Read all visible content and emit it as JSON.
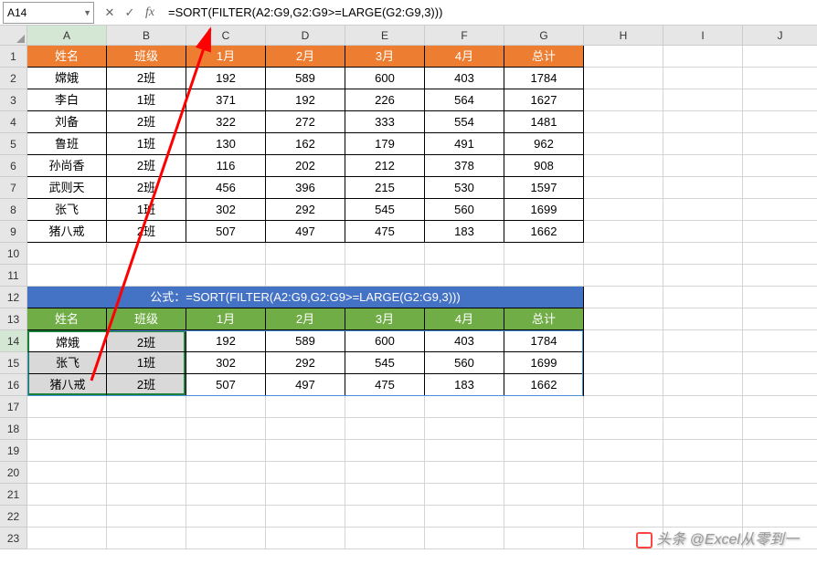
{
  "nameBox": "A14",
  "formula": "=SORT(FILTER(A2:G9,G2:G9>=LARGE(G2:G9,3)))",
  "columns": [
    "A",
    "B",
    "C",
    "D",
    "E",
    "F",
    "G",
    "H",
    "I",
    "J"
  ],
  "rowCount": 23,
  "table1": {
    "headers": [
      "姓名",
      "班级",
      "1月",
      "2月",
      "3月",
      "4月",
      "总计"
    ],
    "rows": [
      [
        "嫦娥",
        "2班",
        "192",
        "589",
        "600",
        "403",
        "1784"
      ],
      [
        "李白",
        "1班",
        "371",
        "192",
        "226",
        "564",
        "1627"
      ],
      [
        "刘备",
        "2班",
        "322",
        "272",
        "333",
        "554",
        "1481"
      ],
      [
        "鲁班",
        "1班",
        "130",
        "162",
        "179",
        "491",
        "962"
      ],
      [
        "孙尚香",
        "2班",
        "116",
        "202",
        "212",
        "378",
        "908"
      ],
      [
        "武则天",
        "2班",
        "456",
        "396",
        "215",
        "530",
        "1597"
      ],
      [
        "张飞",
        "1班",
        "302",
        "292",
        "545",
        "560",
        "1699"
      ],
      [
        "猪八戒",
        "2班",
        "507",
        "497",
        "475",
        "183",
        "1662"
      ]
    ]
  },
  "formulaLabel": "公式：=SORT(FILTER(A2:G9,G2:G9>=LARGE(G2:G9,3)))",
  "table2": {
    "headers": [
      "姓名",
      "班级",
      "1月",
      "2月",
      "3月",
      "4月",
      "总计"
    ],
    "rows": [
      [
        "嫦娥",
        "2班",
        "192",
        "589",
        "600",
        "403",
        "1784"
      ],
      [
        "张飞",
        "1班",
        "302",
        "292",
        "545",
        "560",
        "1699"
      ],
      [
        "猪八戒",
        "2班",
        "507",
        "497",
        "475",
        "183",
        "1662"
      ]
    ]
  },
  "watermark": "头条 @Excel从零到一"
}
